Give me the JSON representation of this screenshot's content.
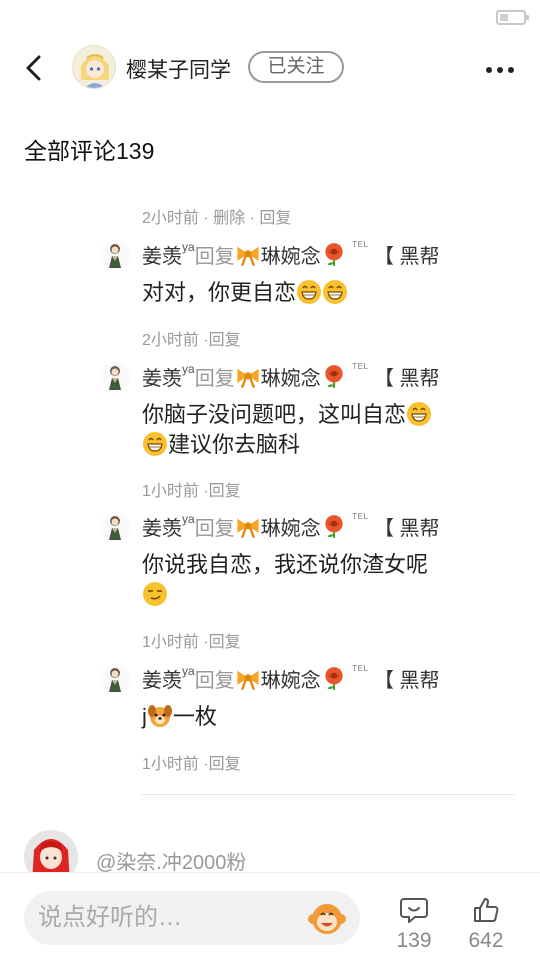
{
  "header": {
    "username": "樱某子同学",
    "follow_label": "已关注"
  },
  "section": {
    "title": "全部评论139"
  },
  "comment": {
    "meta": "2小时前 · 删除 · 回复"
  },
  "replies": [
    {
      "author": "姜羡",
      "author_sup": "ya",
      "verb": "回复",
      "target": "琳婉念",
      "tel": "TEL",
      "tail": "【 黑帮",
      "text": "对对，你更自恋",
      "meta": "2小时前 ·回复",
      "emojis": [
        "grin",
        "grin"
      ]
    },
    {
      "author": "姜羡",
      "author_sup": "ya",
      "verb": "回复",
      "target": "琳婉念",
      "tel": "TEL",
      "tail": "【 黑帮",
      "text_a": "你脑子没问题吧，这叫自恋",
      "text_b": "建议你去脑科",
      "meta": "1小时前 ·回复",
      "emojis": [
        "grin",
        "grin"
      ]
    },
    {
      "author": "姜羡",
      "author_sup": "ya",
      "verb": "回复",
      "target": "琳婉念",
      "tel": "TEL",
      "tail": "【 黑帮",
      "text": "你说我自恋，我还说你渣女呢",
      "meta": "1小时前 ·回复",
      "emojis": [
        "smirk"
      ]
    },
    {
      "author": "姜羡",
      "author_sup": "ya",
      "verb": "回复",
      "target": "琳婉念",
      "tel": "TEL",
      "tail": "【 黑帮",
      "text_a": "j",
      "text_b": "一枚",
      "meta": "1小时前 ·回复",
      "emojis": [
        "dog"
      ]
    }
  ],
  "next_comment": {
    "name": "@染奈.冲2000粉"
  },
  "bottom_bar": {
    "input_placeholder": "说点好听的…",
    "comment_count": "139",
    "like_count": "642"
  },
  "icons": {
    "back": "back-arrow-icon",
    "more": "more-dots-icon",
    "comment": "comment-bubble-icon",
    "like": "thumbs-up-icon",
    "input_emoji": "monkey-emoji-icon",
    "bow": "bow-icon",
    "rose": "rose-icon",
    "battery": "battery-icon"
  },
  "colors": {
    "meta_gray": "#999999",
    "follow_border": "#999999",
    "emoji_yellow": "#f7c12f",
    "bow_orange": "#f5a623",
    "rose_red": "#e8562c"
  }
}
